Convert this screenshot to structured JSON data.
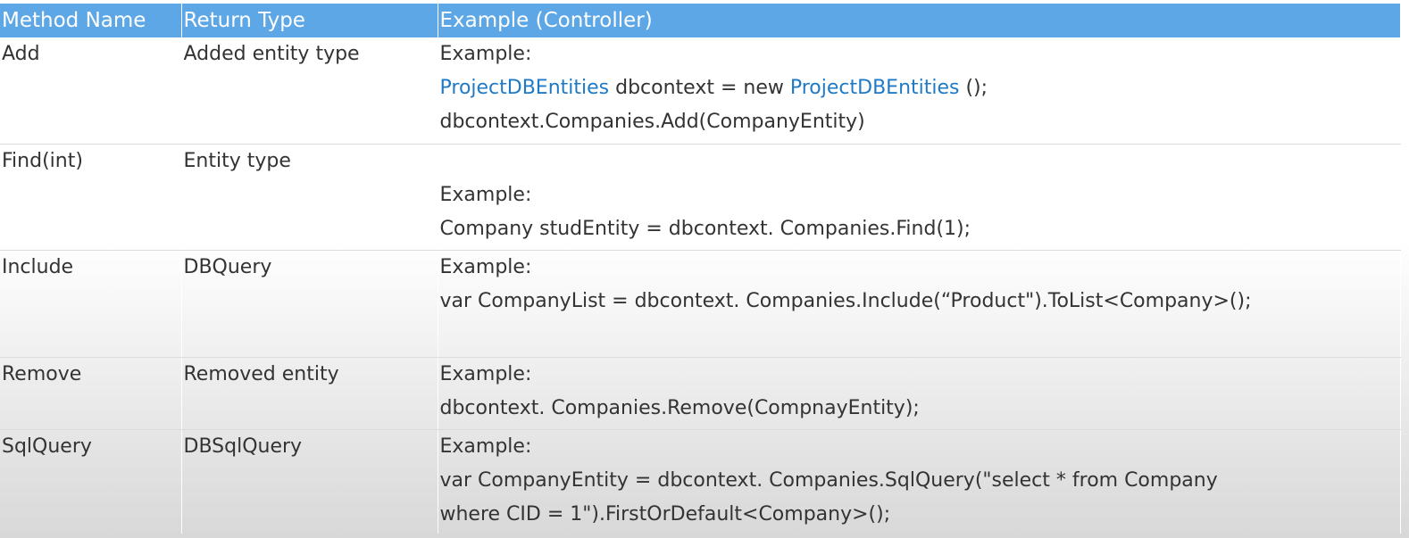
{
  "header": {
    "method_name": "Method Name",
    "return_type": "Return Type",
    "example": "Example (Controller)"
  },
  "rows": [
    {
      "method": "Add",
      "return_type": "Added entity type",
      "example_label": "Example:",
      "code": {
        "type1": "ProjectDBEntities",
        "mid": " dbcontext = new ",
        "type2": "ProjectDBEntities",
        "end": " ();",
        "line2": "dbcontext.Companies.Add(CompanyEntity)"
      }
    },
    {
      "method": "Find(int)",
      "return_type": "Entity type",
      "example_label": "Example:",
      "code": {
        "line1": "Company studEntity = dbcontext. Companies.Find(1);"
      }
    },
    {
      "method": "Include",
      "return_type": "DBQuery",
      "example_label": "Example:",
      "code": {
        "line1": "var CompanyList = dbcontext. Companies.Include(“Product\").ToList<Company>();"
      }
    },
    {
      "method": "Remove",
      "return_type": "Removed entity",
      "example_label": "Example:",
      "code": {
        "line1": "dbcontext. Companies.Remove(CompnayEntity);"
      }
    },
    {
      "method": "SqlQuery",
      "return_type": "DBSqlQuery",
      "example_label": "Example:",
      "code": {
        "line1": "var CompanyEntity = dbcontext. Companies.SqlQuery(\"select * from Company",
        "line2": "where CID = 1\").FirstOrDefault<Company>();"
      }
    }
  ],
  "colors": {
    "header_bg": "#5ea7e6",
    "keyword": "#1f7ac6",
    "text": "#333333"
  }
}
